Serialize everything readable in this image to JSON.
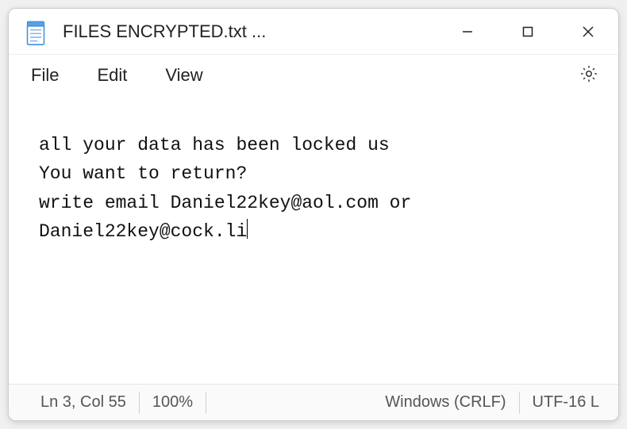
{
  "window": {
    "title": "FILES ENCRYPTED.txt ..."
  },
  "menu": {
    "file": "File",
    "edit": "Edit",
    "view": "View"
  },
  "content": {
    "text": "all your data has been locked us\nYou want to return?\nwrite email Daniel22key@aol.com or Daniel22key@cock.li"
  },
  "status": {
    "position": "Ln 3, Col 55",
    "zoom": "100%",
    "line_ending": "Windows (CRLF)",
    "encoding": "UTF-16 L"
  },
  "icons": {
    "app": "notepad-icon",
    "minimize": "minimize-icon",
    "maximize": "maximize-icon",
    "close": "close-icon",
    "settings": "gear-icon"
  }
}
